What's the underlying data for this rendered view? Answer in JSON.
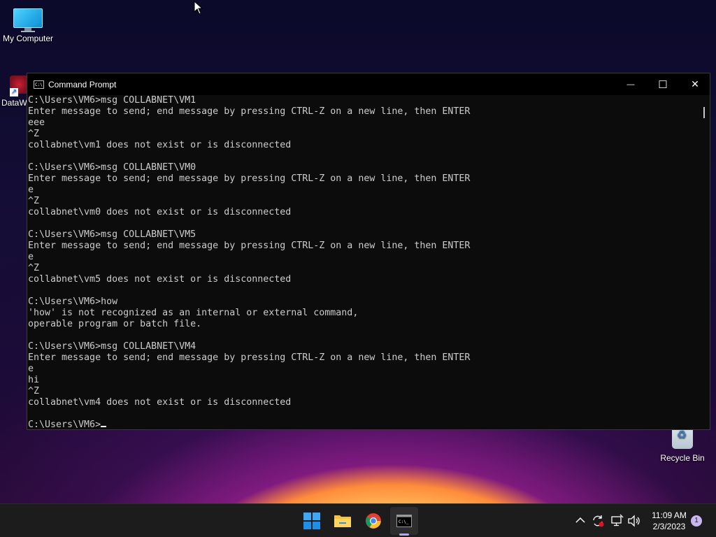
{
  "desktop": {
    "icons": [
      {
        "label": "My Computer"
      },
      {
        "label": "DataW"
      },
      {
        "label": "Recycle Bin"
      }
    ]
  },
  "window": {
    "title": "Command Prompt",
    "buttons": {
      "minimize": "—",
      "maximize": "☐",
      "close": "✕"
    },
    "console_lines": [
      "C:\\Users\\VM6>msg COLLABNET\\VM1",
      "Enter message to send; end message by pressing CTRL-Z on a new line, then ENTER",
      "eee",
      "^Z",
      "collabnet\\vm1 does not exist or is disconnected",
      "",
      "C:\\Users\\VM6>msg COLLABNET\\VM0",
      "Enter message to send; end message by pressing CTRL-Z on a new line, then ENTER",
      "e",
      "^Z",
      "collabnet\\vm0 does not exist or is disconnected",
      "",
      "C:\\Users\\VM6>msg COLLABNET\\VM5",
      "Enter message to send; end message by pressing CTRL-Z on a new line, then ENTER",
      "e",
      "^Z",
      "collabnet\\vm5 does not exist or is disconnected",
      "",
      "C:\\Users\\VM6>how",
      "'how' is not recognized as an internal or external command,",
      "operable program or batch file.",
      "",
      "C:\\Users\\VM6>msg COLLABNET\\VM4",
      "Enter message to send; end message by pressing CTRL-Z on a new line, then ENTER",
      "e",
      "hi",
      "^Z",
      "collabnet\\vm4 does not exist or is disconnected",
      ""
    ],
    "prompt": "C:\\Users\\VM6>"
  },
  "taskbar": {
    "apps": [
      {
        "name": "start-icon"
      },
      {
        "name": "file-explorer-icon"
      },
      {
        "name": "chrome-icon"
      },
      {
        "name": "command-prompt-icon"
      }
    ],
    "tray": {
      "chevron": "^",
      "time": "11:09 AM",
      "date": "2/3/2023",
      "notifications": "1"
    }
  },
  "colors": {
    "console_bg": "#0c0c0c",
    "console_text": "#cccccc",
    "taskbar_bg": "#1c1c1c",
    "accent": "#b9a6e6"
  }
}
